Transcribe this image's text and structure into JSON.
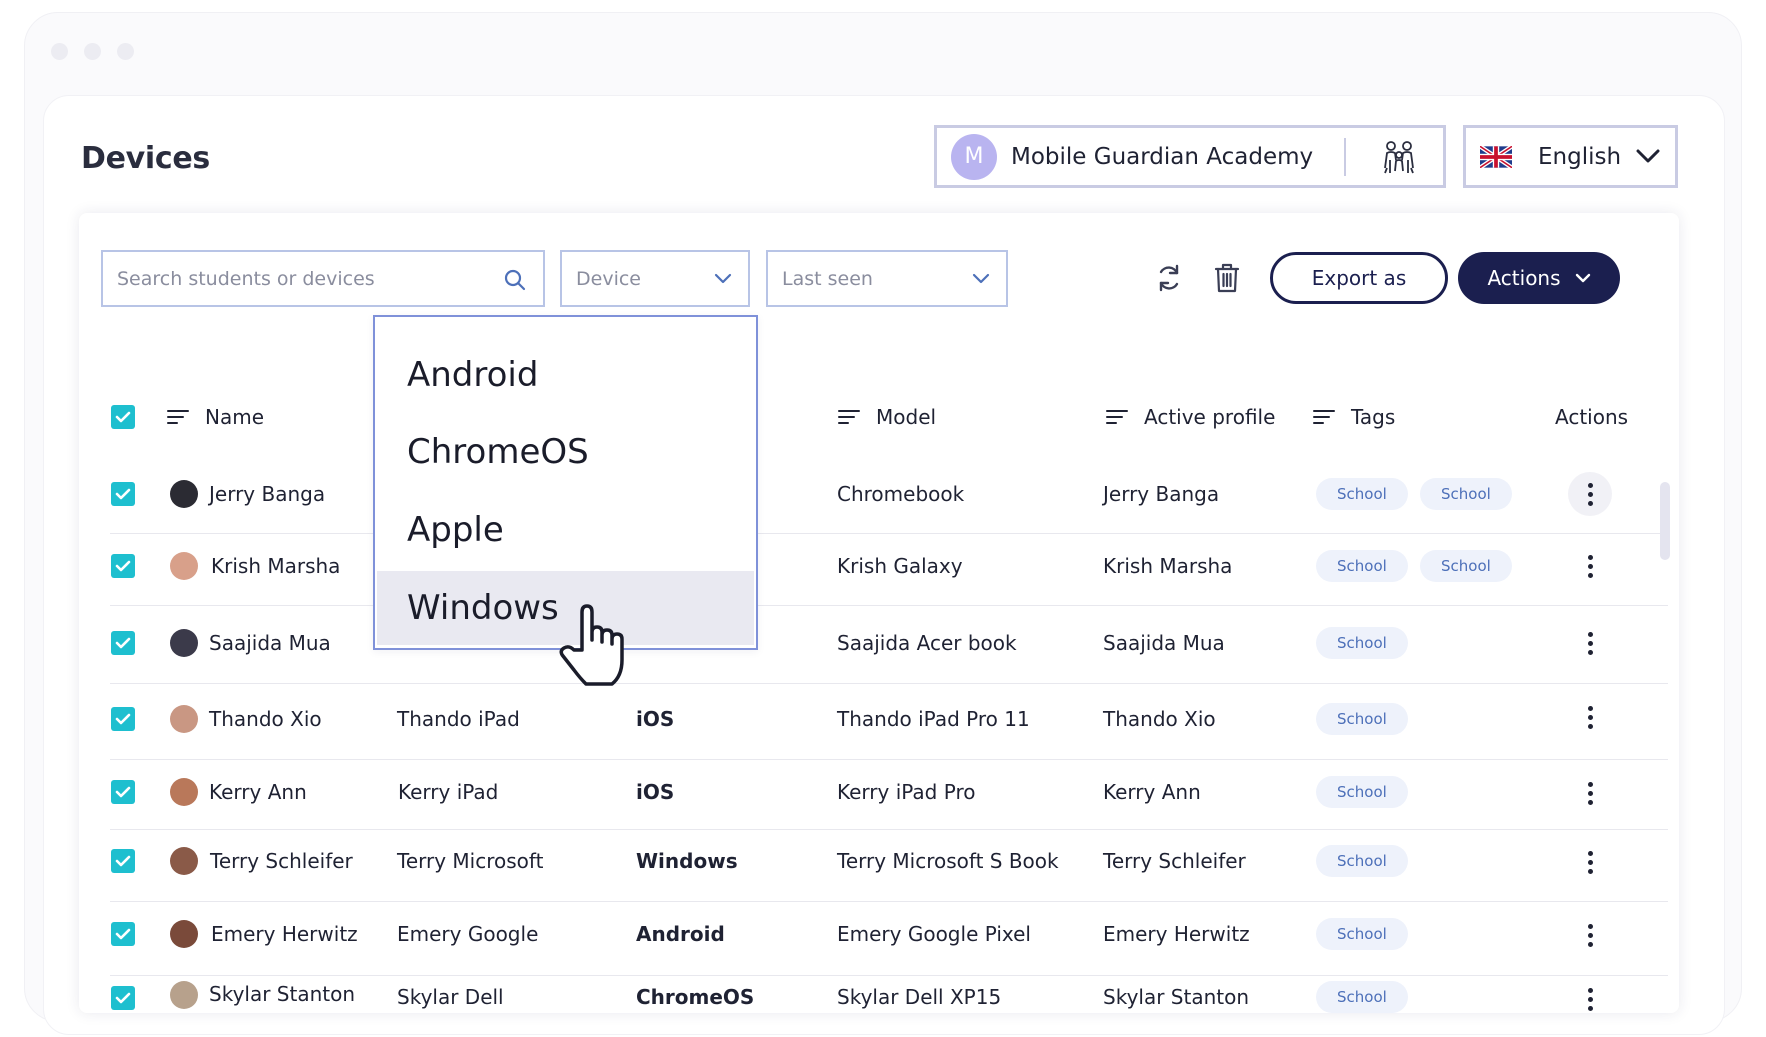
{
  "window": {
    "controls": [
      "close",
      "minimize",
      "maximize"
    ]
  },
  "page": {
    "title": "Devices"
  },
  "school_selector": {
    "initial": "M",
    "name": "Mobile Guardian Academy",
    "family_icon": "family-icon"
  },
  "language": {
    "flag": "uk-flag-icon",
    "label": "English"
  },
  "toolbar": {
    "search_placeholder": "Search students or devices",
    "device_filter": "Device",
    "last_seen_filter": "Last seen",
    "export_label": "Export as",
    "actions_label": "Actions"
  },
  "table": {
    "headers": {
      "name": "Name",
      "model": "Model",
      "active_profile": "Active profile",
      "tags": "Tags",
      "actions": "Actions"
    },
    "rows": [
      {
        "name": "Jerry Banga",
        "device": "",
        "os": "",
        "model": "Chromebook",
        "profile": "Jerry Banga",
        "tags": [
          "School",
          "School"
        ]
      },
      {
        "name": "Krish Marsha",
        "device": "",
        "os": "",
        "model": "Krish Galaxy",
        "profile": "Krish Marsha",
        "tags": [
          "School",
          "School"
        ]
      },
      {
        "name": "Saajida Mua",
        "device": "",
        "os": "",
        "model": "Saajida Acer book",
        "profile": "Saajida Mua",
        "tags": [
          "School"
        ]
      },
      {
        "name": "Thando Xio",
        "device": "Thando iPad",
        "os": "iOS",
        "model": "Thando iPad Pro 11",
        "profile": "Thando Xio",
        "tags": [
          "School"
        ]
      },
      {
        "name": "Kerry Ann",
        "device": "Kerry iPad",
        "os": "iOS",
        "model": "Kerry iPad Pro",
        "profile": "Kerry Ann",
        "tags": [
          "School"
        ]
      },
      {
        "name": "Terry Schleifer",
        "device": "Terry Microsoft",
        "os": "Windows",
        "model": "Terry Microsoft S Book",
        "profile": "Terry Schleifer",
        "tags": [
          "School"
        ]
      },
      {
        "name": "Emery Herwitz",
        "device": "Emery Google",
        "os": "Android",
        "model": "Emery Google Pixel",
        "profile": "Emery Herwitz",
        "tags": [
          "School"
        ]
      },
      {
        "name": "Skylar Stanton",
        "device": "Skylar Dell",
        "os": "ChromeOS",
        "model": "Skylar Dell XP15",
        "profile": "Skylar Stanton",
        "tags": [
          "School"
        ]
      }
    ]
  },
  "device_dropdown": {
    "options": [
      "Android",
      "ChromeOS",
      "Apple",
      "Windows"
    ],
    "hovered": "Windows"
  },
  "colors": {
    "accent_navy": "#1b1f4f",
    "checkbox_teal": "#1ebfcf",
    "tag_bg": "#eef2fb",
    "tag_text": "#4d70b9",
    "avatar_lavender": "#b9b4f0"
  }
}
